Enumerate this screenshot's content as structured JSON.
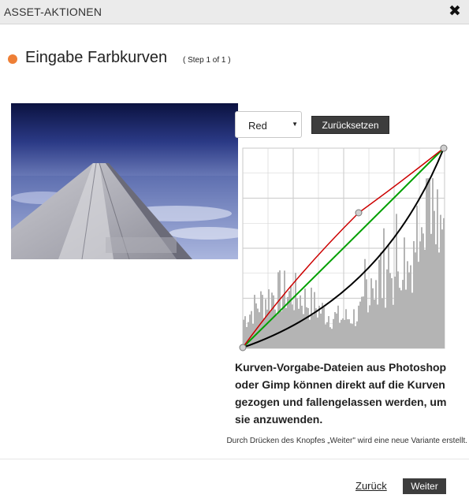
{
  "dialog": {
    "title": "ASSET-AKTIONEN",
    "close_icon": "close-icon"
  },
  "header": {
    "title": "Eingabe Farbkurven",
    "step": "( Step 1 of 1 )",
    "accent_color": "#ee7f36"
  },
  "controls": {
    "channel_selected": "Red",
    "channel_options": [
      "Red"
    ],
    "reset_label": "Zurücksetzen"
  },
  "curves": {
    "colors": {
      "red": "#cc0000",
      "green": "#00a000",
      "black": "#000000",
      "grid": "#d0d0d0",
      "histogram": "#b4b4b4",
      "control_point": "#cfcfcf"
    }
  },
  "hint": "Kurven-Vorgabe-Dateien aus Photoshop oder Gimp können direkt auf die Kurven gezogen und fallengelassen werden, um sie anzuwenden.",
  "info": "Durch Drücken des Knopfes „Weiter\" wird eine neue Variante erstellt.",
  "footer": {
    "back_label": "Zurück",
    "next_label": "Weiter"
  }
}
